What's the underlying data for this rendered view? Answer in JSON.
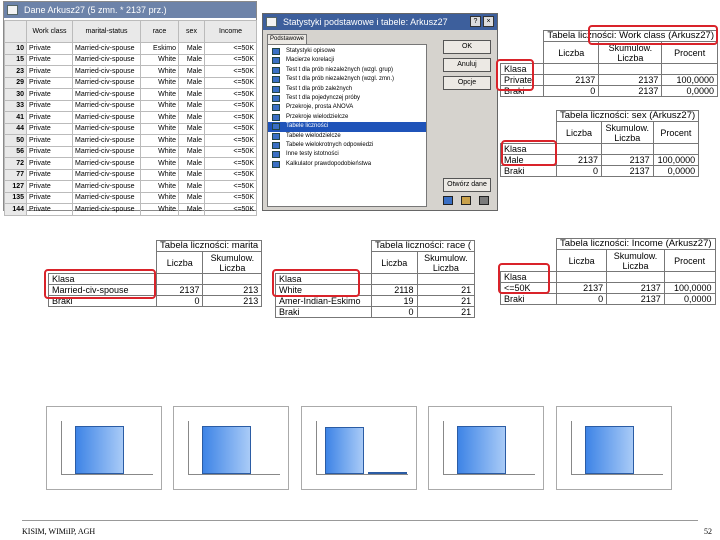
{
  "sheet": {
    "title": "Dane Arkusz27 (5 zmn. * 2137 prz.)",
    "columns": [
      "Work class",
      "marital-status",
      "race",
      "sex",
      "Income"
    ],
    "rows": [
      {
        "id": "10",
        "cells": [
          "Private",
          "Married-civ-spouse",
          "Eskimo",
          "Male",
          "<=50K"
        ]
      },
      {
        "id": "15",
        "cells": [
          "Private",
          "Married-civ-spouse",
          "White",
          "Male",
          "<=50K"
        ]
      },
      {
        "id": "23",
        "cells": [
          "Private",
          "Married-civ-spouse",
          "White",
          "Male",
          "<=50K"
        ]
      },
      {
        "id": "29",
        "cells": [
          "Private",
          "Married-civ-spouse",
          "White",
          "Male",
          "<=50K"
        ]
      },
      {
        "id": "30",
        "cells": [
          "Private",
          "Married-civ-spouse",
          "White",
          "Male",
          "<=50K"
        ]
      },
      {
        "id": "33",
        "cells": [
          "Private",
          "Married-civ-spouse",
          "White",
          "Male",
          "<=50K"
        ]
      },
      {
        "id": "41",
        "cells": [
          "Private",
          "Married-civ-spouse",
          "White",
          "Male",
          "<=50K"
        ]
      },
      {
        "id": "44",
        "cells": [
          "Private",
          "Married-civ-spouse",
          "White",
          "Male",
          "<=50K"
        ]
      },
      {
        "id": "50",
        "cells": [
          "Private",
          "Married-civ-spouse",
          "White",
          "Male",
          "<=50K"
        ]
      },
      {
        "id": "56",
        "cells": [
          "Private",
          "Married-civ-spouse",
          "White",
          "Male",
          "<=50K"
        ]
      },
      {
        "id": "72",
        "cells": [
          "Private",
          "Married-civ-spouse",
          "White",
          "Male",
          "<=50K"
        ]
      },
      {
        "id": "77",
        "cells": [
          "Private",
          "Married-civ-spouse",
          "White",
          "Male",
          "<=50K"
        ]
      },
      {
        "id": "127",
        "cells": [
          "Private",
          "Married-civ-spouse",
          "White",
          "Male",
          "<=50K"
        ]
      },
      {
        "id": "135",
        "cells": [
          "Private",
          "Married-civ-spouse",
          "White",
          "Male",
          "<=50K"
        ]
      },
      {
        "id": "144",
        "cells": [
          "Private",
          "Married-civ-spouse",
          "White",
          "Male",
          "<=50K"
        ]
      }
    ]
  },
  "dialog": {
    "title": "Statystyki podstawowe i tabele: Arkusz27",
    "tab": "Podstawowe",
    "menu": [
      "Statystyki opisowe",
      "Macierze korelacji",
      "Test t dla prób niezależnych (wzgl. grup)",
      "Test t dla prób niezależnych (wzgl. zmn.)",
      "Test t dla prób zależnych",
      "Test t dla pojedynczej próby",
      "Przekroje, prosta ANOVA",
      "Przekroje wielodzielcze",
      "Tabele liczności",
      "Tabele wielodzielcze",
      "Tabele wielokrotnych odpowiedzi",
      "Inne testy istotności",
      "Kalkulator prawdopodobieństwa"
    ],
    "selected_index": 8,
    "buttons": {
      "ok": "OK",
      "cancel": "Anuluj",
      "options": "Opcje",
      "open_data": "Otwórz dane"
    }
  },
  "freq_tables": [
    {
      "title": "Tabela liczności: Work class (Arkusz27)",
      "headers": [
        "Liczba",
        "Skumulow. Liczba",
        "Procent"
      ],
      "rowlabel": "Klasa",
      "rows": [
        {
          "label": "Private",
          "values": [
            "2137",
            "2137",
            "100,0000"
          ]
        },
        {
          "label": "Braki",
          "values": [
            "0",
            "2137",
            "0,0000"
          ]
        }
      ]
    },
    {
      "title": "Tabela liczności: sex (Arkusz27)",
      "headers": [
        "Liczba",
        "Skumulow. Liczba",
        "Procent"
      ],
      "rowlabel": "Klasa",
      "rows": [
        {
          "label": "Male",
          "values": [
            "2137",
            "2137",
            "100,0000"
          ]
        },
        {
          "label": "Braki",
          "values": [
            "0",
            "2137",
            "0,0000"
          ]
        }
      ]
    },
    {
      "title": "Tabela liczności: marita",
      "headers": [
        "Liczba",
        "Skumulow. Liczba"
      ],
      "rowlabel": "Klasa",
      "rows": [
        {
          "label": "Married-civ-spouse",
          "values": [
            "2137",
            "213"
          ]
        },
        {
          "label": "Braki",
          "values": [
            "0",
            "213"
          ]
        }
      ]
    },
    {
      "title": "Tabela liczności: race (",
      "headers": [
        "Liczba",
        "Skumulow. Liczba"
      ],
      "rowlabel": "Klasa",
      "rows": [
        {
          "label": "White",
          "values": [
            "2118",
            "21"
          ]
        },
        {
          "label": "Amer-Indian-Eskimo",
          "values": [
            "19",
            "21"
          ]
        },
        {
          "label": "Braki",
          "values": [
            "0",
            "21"
          ]
        }
      ]
    },
    {
      "title": "Tabela liczności: Income (Arkusz27)",
      "headers": [
        "Liczba",
        "Skumulow. Liczba",
        "Procent"
      ],
      "rowlabel": "Klasa",
      "rows": [
        {
          "label": "<=50K",
          "values": [
            "2137",
            "2137",
            "100,0000"
          ]
        },
        {
          "label": "Braki",
          "values": [
            "0",
            "2137",
            "0,0000"
          ]
        }
      ]
    }
  ],
  "histograms": [
    {
      "bars": [
        2137
      ],
      "ymax": 2500
    },
    {
      "bars": [
        2137
      ],
      "ymax": 2500
    },
    {
      "bars": [
        2118,
        19
      ],
      "ymax": 2500
    },
    {
      "bars": [
        2137
      ],
      "ymax": 2500
    },
    {
      "bars": [
        2137
      ],
      "ymax": 2500
    }
  ],
  "footer": {
    "left": "KISIM, WIMiIP, AGH",
    "right": "52"
  },
  "colors": {
    "accent_red": "#d9232a",
    "titlebar": "#6d83a9",
    "selection": "#1f53b9"
  }
}
